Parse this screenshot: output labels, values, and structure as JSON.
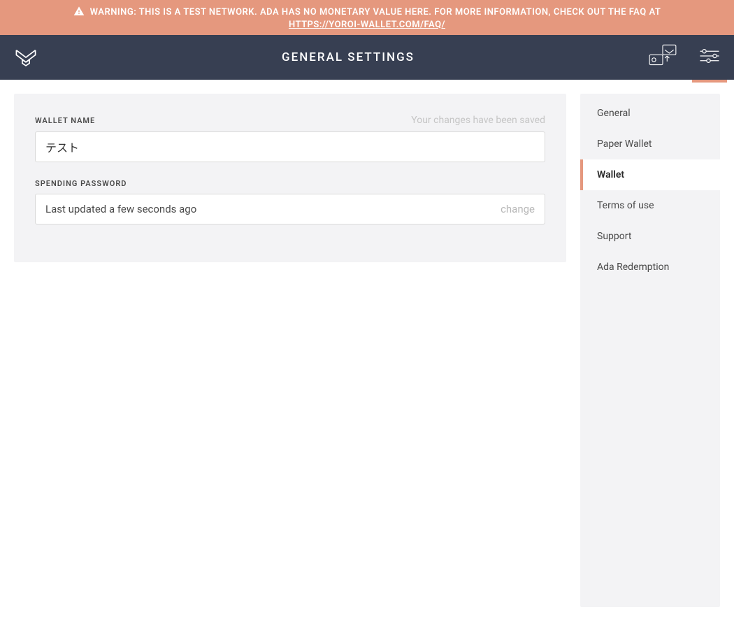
{
  "banner": {
    "warning_text": "WARNING: THIS IS A TEST NETWORK. ADA HAS NO MONETARY VALUE HERE. FOR MORE INFORMATION, CHECK OUT THE FAQ AT",
    "faq_link": "HTTPS://YOROI-WALLET.COM/FAQ/"
  },
  "header": {
    "title": "GENERAL SETTINGS"
  },
  "main": {
    "wallet_name": {
      "label": "WALLET NAME",
      "status": "Your changes have been saved",
      "value": "テスト"
    },
    "spending_password": {
      "label": "SPENDING PASSWORD",
      "status": "Last updated a few seconds ago",
      "change_label": "change"
    }
  },
  "sidebar": {
    "items": [
      {
        "label": "General"
      },
      {
        "label": "Paper Wallet"
      },
      {
        "label": "Wallet"
      },
      {
        "label": "Terms of use"
      },
      {
        "label": "Support"
      },
      {
        "label": "Ada Redemption"
      }
    ]
  }
}
